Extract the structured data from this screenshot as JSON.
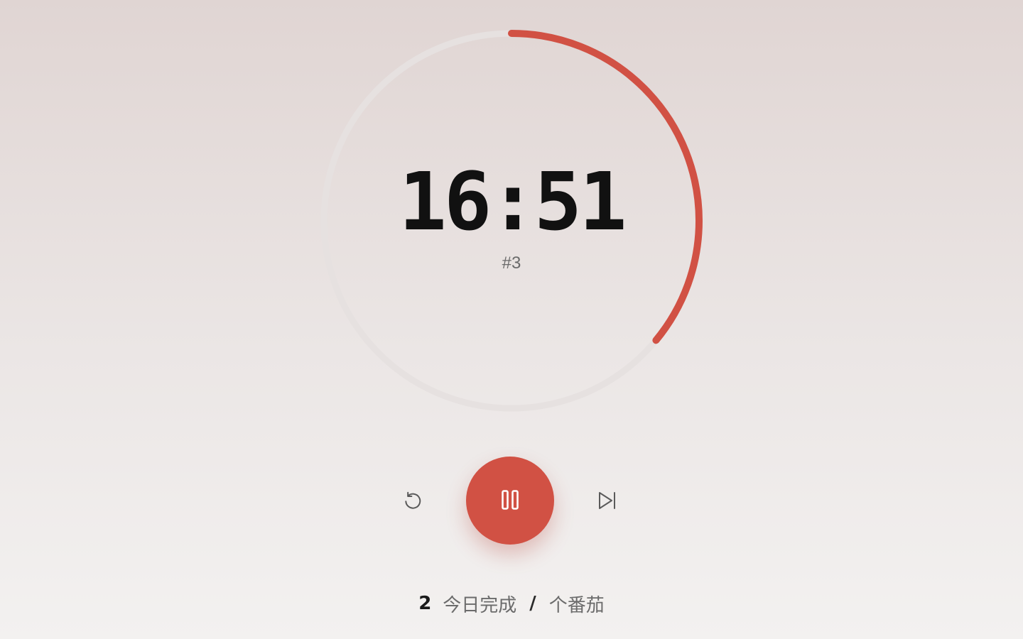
{
  "timer": {
    "time": "16:51",
    "session": "#3",
    "progress_fraction": 0.36,
    "progress_color": "#d15144",
    "track_color": "#e6e1e0"
  },
  "controls": {
    "reset_icon": "reset-icon",
    "pause_icon": "pause-icon",
    "skip_icon": "skip-next-icon",
    "accent_color": "#d15144"
  },
  "stats": {
    "count": "2",
    "completed_label": "今日完成",
    "separator": "/",
    "unit_label": "个番茄"
  }
}
